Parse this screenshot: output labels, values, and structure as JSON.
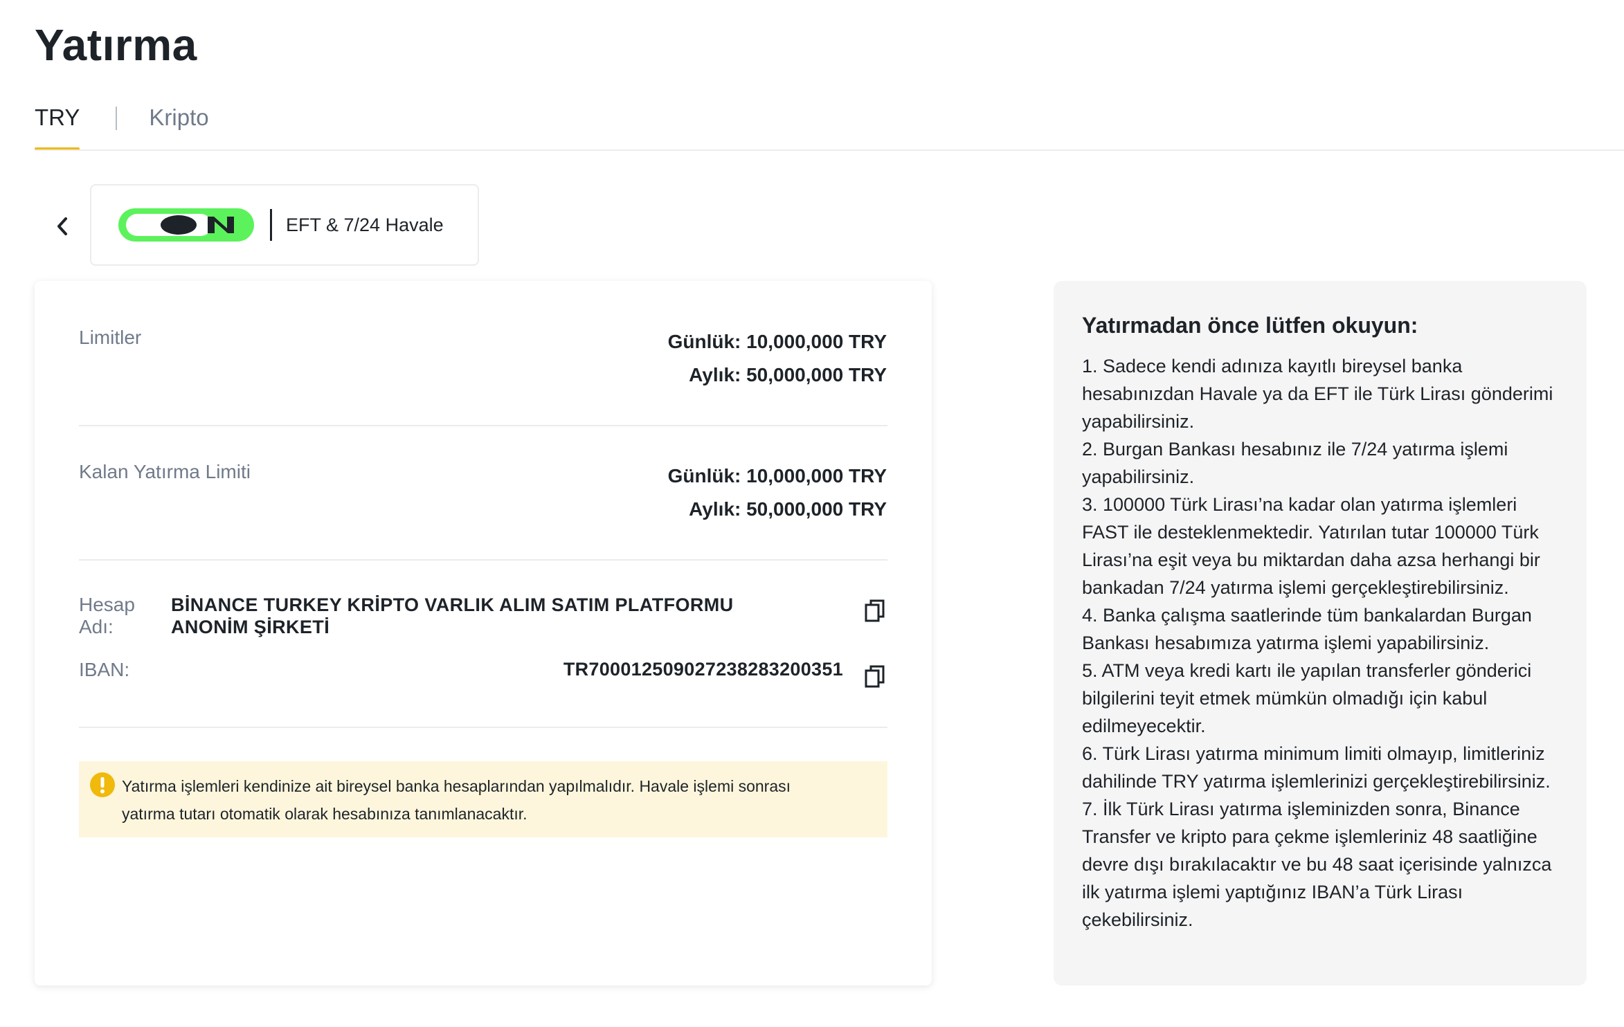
{
  "page": {
    "title": "Yatırma"
  },
  "tabs": [
    {
      "label": "TRY",
      "active": true
    },
    {
      "label": "Kripto",
      "active": false
    }
  ],
  "method": {
    "logo_text": "ON",
    "label": "EFT & 7/24 Havale",
    "logo_colors": {
      "green": "#5cf25c",
      "dark": "#1e2329"
    }
  },
  "limits": {
    "label": "Limitler",
    "daily": "Günlük: 10,000,000 TRY",
    "monthly": "Aylık: 50,000,000 TRY"
  },
  "remaining": {
    "label": "Kalan Yatırma Limiti",
    "daily": "Günlük: 10,000,000 TRY",
    "monthly": "Aylık: 50,000,000 TRY"
  },
  "account": {
    "name_label_line1": "Hesap",
    "name_label_line2": "Adı:",
    "name": "BİNANCE TURKEY KRİPTO VARLIK ALIM SATIM PLATFORMU ANONİM ŞİRKETİ",
    "iban_label": "IBAN:",
    "iban": "TR700012509027238283200351"
  },
  "notice": {
    "line1": "Yatırma işlemleri kendinize ait bireysel banka hesaplarından yapılmalıdır. Havale işlemi sonrası",
    "line2": "yatırma tutarı otomatik olarak hesabınıza tanımlanacaktır.",
    "icon": "exclamation-icon",
    "color": "#f0b90b"
  },
  "info": {
    "title": "Yatırmadan önce lütfen okuyun:",
    "items": [
      "1. Sadece kendi adınıza kayıtlı bireysel banka hesabınızdan Havale ya da EFT ile Türk Lirası gönderimi yapabilirsiniz.",
      "2. Burgan Bankası hesabınız ile 7/24 yatırma işlemi yapabilirsiniz.",
      "3. 100000 Türk Lirası’na kadar olan yatırma işlemleri FAST ile desteklenmektedir. Yatırılan tutar 100000 Türk Lirası’na eşit veya bu miktardan daha azsa herhangi bir bankadan 7/24 yatırma işlemi gerçekleştirebilirsiniz.",
      "4. Banka çalışma saatlerinde tüm bankalardan Burgan Bankası hesabımıza yatırma işlemi yapabilirsiniz.",
      "5. ATM veya kredi kartı ile yapılan transferler gönderici bilgilerini teyit etmek mümkün olmadığı için kabul edilmeyecektir.",
      "6. Türk Lirası yatırma minimum limiti olmayıp, limitleriniz dahilinde TRY yatırma işlemlerinizi gerçekleştirebilirsiniz.",
      "7. İlk Türk Lirası yatırma işleminizden sonra, Binance Transfer ve kripto para çekme işlemleriniz 48 saatliğine devre dışı bırakılacaktır ve bu 48 saat içerisinde yalnızca ilk yatırma işlemi yaptığınız IBAN’a Türk Lirası çekebilirsiniz."
    ]
  }
}
